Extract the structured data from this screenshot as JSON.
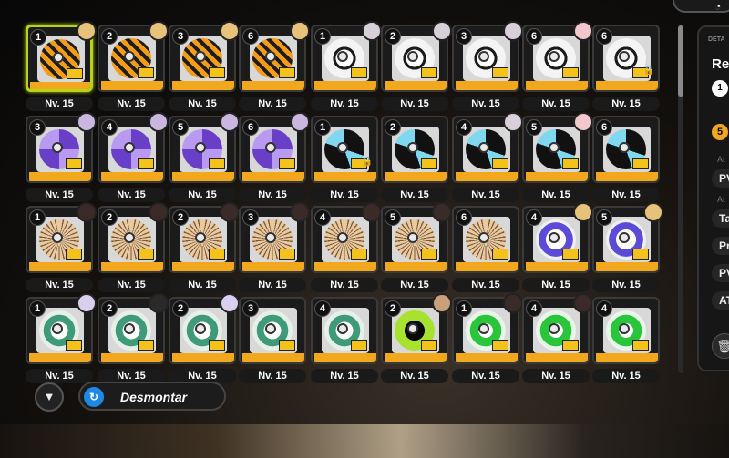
{
  "colors": {
    "accent_selected": "#b8d41a",
    "level_bar": "#f2a81d",
    "disassemble_icon": "#1e88e5"
  },
  "discs": [
    [
      {
        "rank": "1",
        "level": "Nv. 15",
        "style": "tiger",
        "avatar": "#e7c27a",
        "selected": true,
        "locked": false
      },
      {
        "rank": "2",
        "level": "Nv. 15",
        "style": "tiger",
        "avatar": "#e7c27a",
        "selected": false,
        "locked": false
      },
      {
        "rank": "3",
        "level": "Nv. 15",
        "style": "tiger",
        "avatar": "#e7c27a",
        "selected": false,
        "locked": false
      },
      {
        "rank": "6",
        "level": "Nv. 15",
        "style": "tiger",
        "avatar": "#e7c27a",
        "selected": false,
        "locked": false
      },
      {
        "rank": "1",
        "level": "Nv. 15",
        "style": "white",
        "avatar": "#d8d0d8",
        "selected": false,
        "locked": false
      },
      {
        "rank": "2",
        "level": "Nv. 15",
        "style": "white",
        "avatar": "#d8d0d8",
        "selected": false,
        "locked": false
      },
      {
        "rank": "3",
        "level": "Nv. 15",
        "style": "white",
        "avatar": "#d8d0d8",
        "selected": false,
        "locked": false
      },
      {
        "rank": "6",
        "level": "Nv. 15",
        "style": "white",
        "avatar": "#f2c8cc",
        "selected": false,
        "locked": false
      },
      {
        "rank": "6",
        "level": "Nv. 15",
        "style": "white",
        "avatar": "",
        "selected": false,
        "locked": true
      }
    ],
    [
      {
        "rank": "3",
        "level": "Nv. 15",
        "style": "purple",
        "avatar": "#c9b7e0",
        "selected": false,
        "locked": false
      },
      {
        "rank": "4",
        "level": "Nv. 15",
        "style": "purple",
        "avatar": "#c9b7e0",
        "selected": false,
        "locked": false
      },
      {
        "rank": "5",
        "level": "Nv. 15",
        "style": "purple",
        "avatar": "#c9b7e0",
        "selected": false,
        "locked": false
      },
      {
        "rank": "6",
        "level": "Nv. 15",
        "style": "purple",
        "avatar": "#c9b7e0",
        "selected": false,
        "locked": false
      },
      {
        "rank": "1",
        "level": "Nv. 15",
        "style": "cyan",
        "avatar": "",
        "selected": false,
        "locked": true
      },
      {
        "rank": "2",
        "level": "Nv. 15",
        "style": "cyan",
        "avatar": "",
        "selected": false,
        "locked": false
      },
      {
        "rank": "4",
        "level": "Nv. 15",
        "style": "cyan",
        "avatar": "#d8d0d8",
        "selected": false,
        "locked": false
      },
      {
        "rank": "5",
        "level": "Nv. 15",
        "style": "cyan",
        "avatar": "#f2c8cc",
        "selected": false,
        "locked": false
      },
      {
        "rank": "6",
        "level": "Nv. 15",
        "style": "cyan",
        "avatar": "",
        "selected": false,
        "locked": false
      }
    ],
    [
      {
        "rank": "1",
        "level": "Nv. 15",
        "style": "sun",
        "avatar": "#3a2a28",
        "selected": false,
        "locked": false
      },
      {
        "rank": "2",
        "level": "Nv. 15",
        "style": "sun",
        "avatar": "#3a2a28",
        "selected": false,
        "locked": false
      },
      {
        "rank": "2",
        "level": "Nv. 15",
        "style": "sun",
        "avatar": "#3a2a28",
        "selected": false,
        "locked": false
      },
      {
        "rank": "3",
        "level": "Nv. 15",
        "style": "sun",
        "avatar": "#3a2a28",
        "selected": false,
        "locked": false
      },
      {
        "rank": "4",
        "level": "Nv. 15",
        "style": "sun",
        "avatar": "#3a2a28",
        "selected": false,
        "locked": false
      },
      {
        "rank": "5",
        "level": "Nv. 15",
        "style": "sun",
        "avatar": "#3a2a28",
        "selected": false,
        "locked": false
      },
      {
        "rank": "6",
        "level": "Nv. 15",
        "style": "sun",
        "avatar": "",
        "selected": false,
        "locked": false
      },
      {
        "rank": "4",
        "level": "Nv. 15",
        "style": "blue",
        "avatar": "#e7c27a",
        "selected": false,
        "locked": false
      },
      {
        "rank": "5",
        "level": "Nv. 15",
        "style": "blue",
        "avatar": "#e7c27a",
        "selected": false,
        "locked": false
      }
    ],
    [
      {
        "rank": "1",
        "level": "Nv. 15",
        "style": "green",
        "avatar": "#d8d0ee",
        "selected": false,
        "locked": false
      },
      {
        "rank": "2",
        "level": "Nv. 15",
        "style": "green",
        "avatar": "#2a2a2a",
        "selected": false,
        "locked": false
      },
      {
        "rank": "2",
        "level": "Nv. 15",
        "style": "green",
        "avatar": "#d8d0ee",
        "selected": false,
        "locked": false
      },
      {
        "rank": "3",
        "level": "Nv. 15",
        "style": "green",
        "avatar": "",
        "selected": false,
        "locked": false
      },
      {
        "rank": "4",
        "level": "Nv. 15",
        "style": "green",
        "avatar": "",
        "selected": false,
        "locked": false
      },
      {
        "rank": "2",
        "level": "Nv. 15",
        "style": "lime",
        "avatar": "#c9a07a",
        "selected": false,
        "locked": false
      },
      {
        "rank": "1",
        "level": "Nv. 15",
        "style": "neon",
        "avatar": "#3a2a28",
        "selected": false,
        "locked": false
      },
      {
        "rank": "4",
        "level": "Nv. 15",
        "style": "neon",
        "avatar": "#3a2a28",
        "selected": false,
        "locked": false
      },
      {
        "rank": "4",
        "level": "Nv. 15",
        "style": "neon",
        "avatar": "",
        "selected": false,
        "locked": false
      }
    ]
  ],
  "side_panel": {
    "header": "DETA",
    "name": "Re",
    "level": "1",
    "coin": "5",
    "sub1": "At",
    "stat1": "PV",
    "sub2": "At",
    "stat2": "Ta",
    "stat3": "Pr",
    "stat4": "PV",
    "stat5": "AT"
  },
  "toolbar": {
    "filter_icon": "filter-icon",
    "disassemble_label": "Desmontar"
  }
}
